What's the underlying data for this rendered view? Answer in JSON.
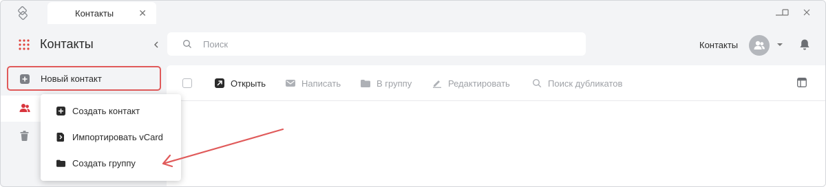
{
  "window": {
    "tab_label": "Контакты",
    "tab_close": "✕"
  },
  "sidebar": {
    "title": "Контакты",
    "new_contact_label": "Новый контакт"
  },
  "search": {
    "placeholder": "Поиск"
  },
  "header": {
    "section_label": "Контакты"
  },
  "toolbar": {
    "open_label": "Открыть",
    "write_label": "Написать",
    "to_group_label": "В группу",
    "edit_label": "Редактировать",
    "duplicates_label": "Поиск дубликатов"
  },
  "menu": {
    "items": [
      {
        "label": "Создать контакт",
        "icon": "plus-square-icon"
      },
      {
        "label": "Импортировать vCard",
        "icon": "import-file-icon"
      },
      {
        "label": "Создать группу",
        "icon": "folder-icon"
      }
    ]
  },
  "colors": {
    "accent": "#e05a5a",
    "active_icon": "#d9363e",
    "text": "#2b2b2b",
    "muted": "#9fa2a7",
    "background": "#f3f4f6"
  }
}
